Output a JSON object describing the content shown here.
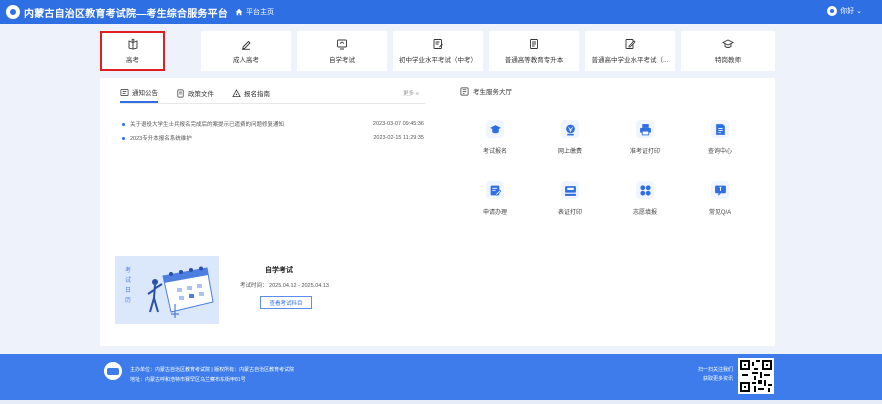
{
  "header": {
    "title": "内蒙古自治区教育考试院—考生综合服务平台",
    "home_label": "平台主页",
    "user_label": "你好 ⌄"
  },
  "categories": [
    {
      "label": "高考",
      "icon": "book-icon",
      "selected": true
    },
    {
      "label": "成人高考",
      "icon": "pen-icon",
      "selected": false
    },
    {
      "label": "自学考试",
      "icon": "screen-icon",
      "selected": false
    },
    {
      "label": "初中学业水平考试（中考）",
      "icon": "exam-paper-icon",
      "selected": false
    },
    {
      "label": "普通高等教育专升本",
      "icon": "document-icon",
      "selected": false
    },
    {
      "label": "普通高中学业水平考试（...",
      "icon": "edit-doc-icon",
      "selected": false
    },
    {
      "label": "特岗教师",
      "icon": "graduation-cap-icon",
      "selected": false
    }
  ],
  "tabs": [
    {
      "label": "通知公告",
      "active": true
    },
    {
      "label": "政策文件",
      "active": false
    },
    {
      "label": "报名指南",
      "active": false
    }
  ],
  "more_label": "更多 ≡",
  "news": [
    {
      "title": "关于退役大学生士兵报名完成后的案提示已遗费的问题修复通知",
      "time": "2023-03-07 09:45:36"
    },
    {
      "title": "2023专升本报名系统维护",
      "time": "2023-02-15 11:29:35"
    }
  ],
  "exam": {
    "image_text": "考试日历",
    "title": "自学考试",
    "time": "考试时间：  2025.04.12 - 2025.04.13",
    "button": "查看考试科目"
  },
  "services": {
    "title": "考生服务大厅",
    "items": [
      {
        "label": "考试报名",
        "icon": "graduation-cap-icon"
      },
      {
        "label": "网上缴费",
        "icon": "coin-icon"
      },
      {
        "label": "准考证打印",
        "icon": "printer-icon"
      },
      {
        "label": "查询中心",
        "icon": "document-search-icon"
      },
      {
        "label": "申请办理",
        "icon": "edit-form-icon"
      },
      {
        "label": "表证打印",
        "icon": "print-form-icon"
      },
      {
        "label": "志愿填报",
        "icon": "grid-apps-icon"
      },
      {
        "label": "常见Q/A",
        "icon": "chat-icon"
      }
    ]
  },
  "footer": {
    "line1": "主办单位：内蒙古自治区教育考试院 | 版权所有：内蒙古自治区教育考试院",
    "line2": "地址：内蒙古呼和浩特市赛罕区乌兰察布东街甲81号",
    "qr_line1": "扫一扫关注我们",
    "qr_line2": "获取更多资讯"
  },
  "colors": {
    "primary": "#2f6fe4",
    "selected_outline": "#e02020",
    "footer": "#3d7cea"
  }
}
